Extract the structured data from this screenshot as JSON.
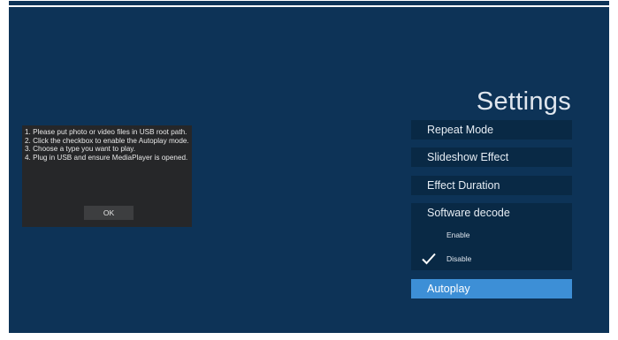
{
  "dialog": {
    "message": "1. Please put photo or video files in USB root path.\n2. Click the checkbox to enable the Autoplay mode.\n3. Choose a type you want to play.\n4. Plug in USB and ensure MediaPlayer is opened.",
    "ok_label": "OK"
  },
  "settings": {
    "title": "Settings",
    "items": [
      {
        "label": "Repeat Mode"
      },
      {
        "label": "Slideshow Effect"
      },
      {
        "label": "Effect Duration"
      },
      {
        "label": "Software decode"
      }
    ],
    "software_decode_options": [
      {
        "label": "Enable",
        "selected": false
      },
      {
        "label": "Disable",
        "selected": true
      }
    ],
    "autoplay_label": "Autoplay",
    "check_icon": "check-icon"
  },
  "colors": {
    "background": "#0d3357",
    "menu_item": "#092945",
    "highlight": "#3d8fd6",
    "dialog": "#262729",
    "button": "#3d3e40"
  }
}
